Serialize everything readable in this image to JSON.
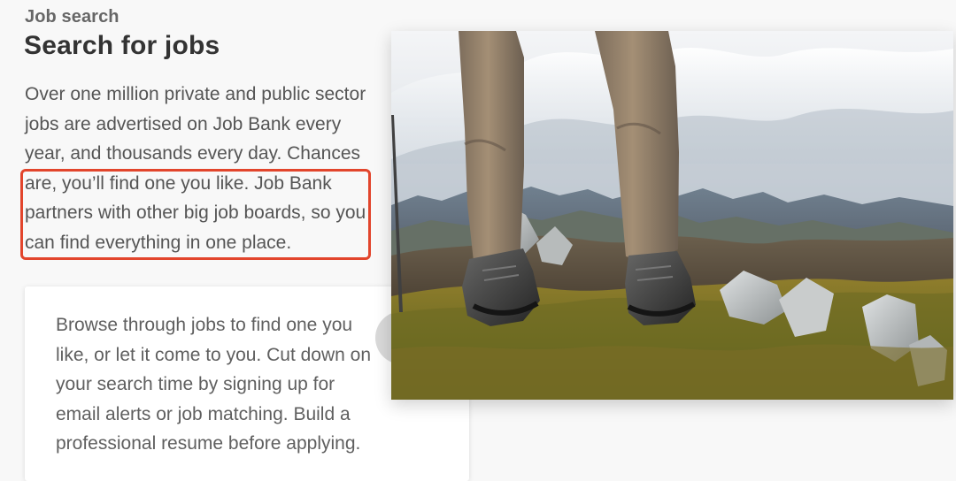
{
  "header": {
    "eyebrow": "Job search",
    "title": "Search for jobs"
  },
  "intro": {
    "text": "Over one million private and public sector jobs are advertised on Job Bank every year, and thousands every day. Chances are, you’ll find one you like. Job Bank partners with other big job boards, so you can find everything in one place."
  },
  "card": {
    "text": "Browse through jobs to find one you like, or let it come to you. Cut down on your search time by signing up for email alerts or job matching. Build a professional resume before applying.",
    "icon": "info-icon"
  },
  "image": {
    "subject": "hiker-boots-on-mountain-photo"
  },
  "colors": {
    "highlight": "#e2452c",
    "icon_bg": "#d8d8d8",
    "text": "#555555",
    "title": "#333333"
  }
}
